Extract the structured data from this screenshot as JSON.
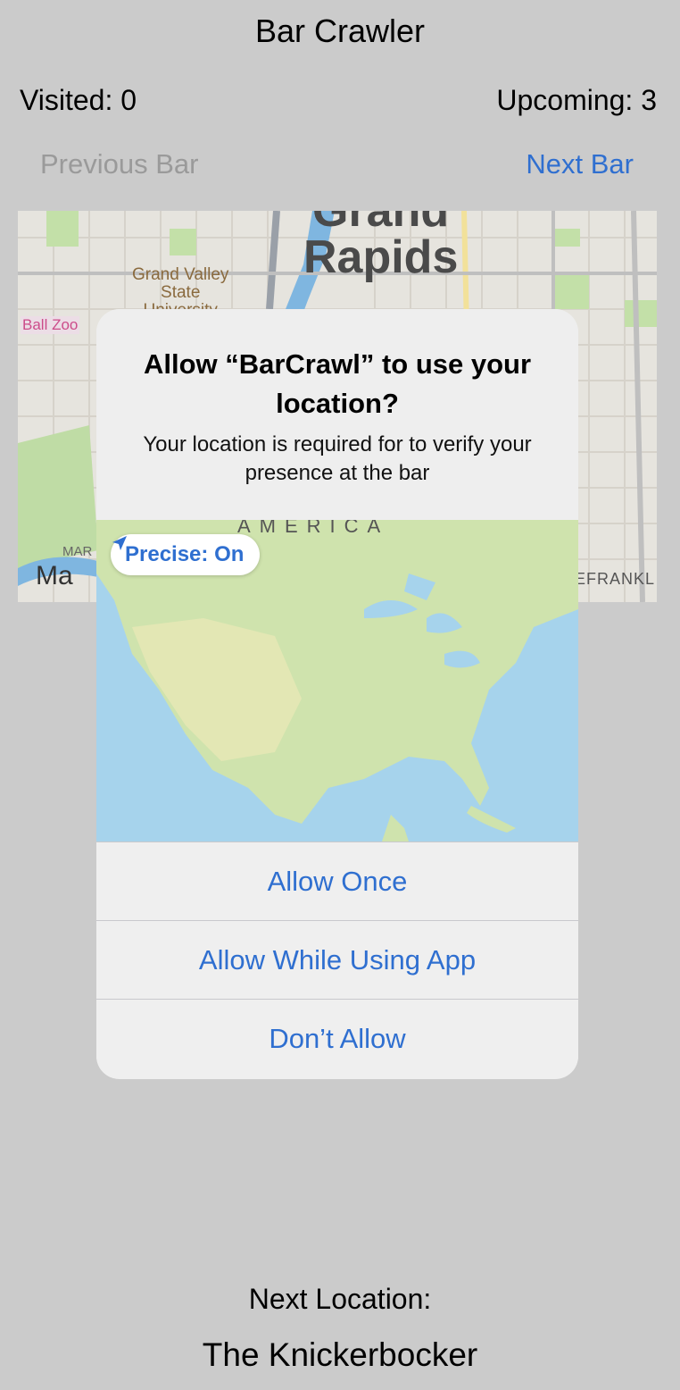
{
  "app": {
    "title": "Bar Crawler"
  },
  "stats": {
    "visited": "Visited: 0",
    "upcoming": "Upcoming: 3"
  },
  "nav": {
    "previous": "Previous Bar",
    "next": "Next Bar"
  },
  "map": {
    "city_label_top": "Grand",
    "city_label": "Rapids",
    "university": "Grand Valley\nState\nUniversity",
    "zoo": "Ball Zoo",
    "market": "MAR",
    "apple_maps": "Ma",
    "lefrank": "LEFRANKL"
  },
  "dialog": {
    "title": "Allow “BarCrawl” to use your location?",
    "message": "Your location is required for to verify your presence at the bar",
    "map_region_label": "AMERICA",
    "precise_label": "Precise: On",
    "buttons": {
      "allow_once": "Allow Once",
      "allow_while_using": "Allow While Using App",
      "dont_allow": "Don’t Allow"
    }
  },
  "footer": {
    "next_location_label": "Next Location:",
    "next_location": "The Knickerbocker"
  },
  "colors": {
    "accent": "#2f6fd0",
    "background": "#cbcbcb",
    "disabled": "#9a9a9a"
  }
}
